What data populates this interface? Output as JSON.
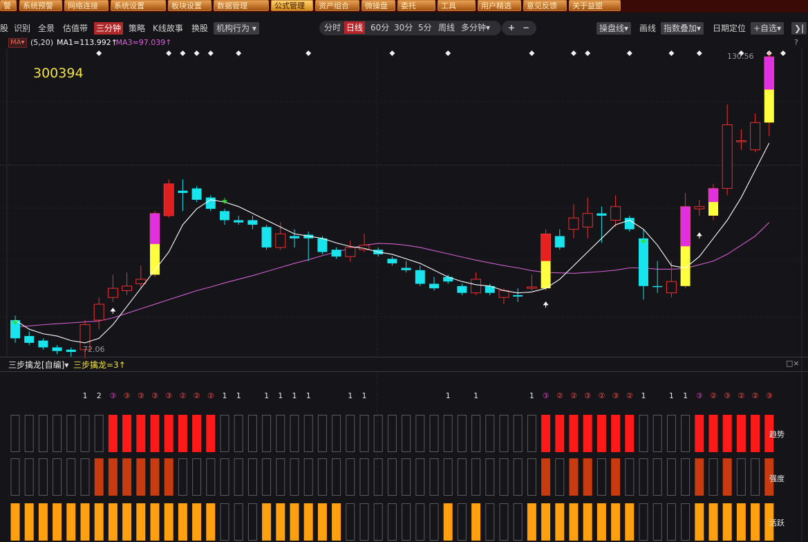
{
  "menu": {
    "items": [
      "警",
      "系统预警",
      "网络连接",
      "系统设置",
      "板块设置",
      "数据管理",
      "公式管理",
      "资产组合",
      "微操盘",
      "委托",
      "工具",
      "用户精选",
      "意见反馈",
      "关于益盟"
    ],
    "active_index": 6
  },
  "toolbar": {
    "left_items": [
      "股",
      "识别",
      "全景",
      "估值带",
      "三分钟",
      "策略",
      "K线故事",
      "换股"
    ],
    "selected_left": "三分钟",
    "org_behavior": "机构行为",
    "periods": [
      "分时",
      "日线",
      "60分",
      "30分",
      "5分",
      "周线",
      "多分钟"
    ],
    "selected_period": "日线",
    "plus": "+",
    "minus": "−",
    "right_items": [
      "操盘线",
      "画线",
      "指数叠加",
      "日期定位",
      "+自选"
    ],
    "collapse": "❯|"
  },
  "ma_legend": {
    "selector": "MA",
    "params": "(5,20)",
    "ma1": "MA1=113.992↑",
    "ma3": ",MA3=97.039↑"
  },
  "stock_code": "300394",
  "price_high_label": "130.56",
  "price_low_label": "72.06",
  "help_icon": "?",
  "indicator": {
    "name": "三步擒龙[自编]",
    "value": "三步擒龙=3↑",
    "close": "□×"
  },
  "row_labels": [
    "趋势",
    "强度",
    "活跃"
  ],
  "colors": {
    "up": "#f03030",
    "down": "#19e4ee",
    "ma1": "#ffffff",
    "ma3": "#d060d0",
    "trend": "#ff1a1a",
    "strength": "#c83a10",
    "activity": "#ffa010"
  },
  "signals": [
    {
      "i": 5,
      "t": "1"
    },
    {
      "i": 6,
      "t": "2"
    },
    {
      "i": 7,
      "t": "③",
      "c3": true
    },
    {
      "i": 8,
      "t": "③",
      "c": true
    },
    {
      "i": 9,
      "t": "③",
      "c": true
    },
    {
      "i": 10,
      "t": "③",
      "c": true
    },
    {
      "i": 11,
      "t": "③",
      "c": true
    },
    {
      "i": 12,
      "t": "②",
      "c": true
    },
    {
      "i": 13,
      "t": "②",
      "c": true
    },
    {
      "i": 14,
      "t": "②",
      "c": true
    },
    {
      "i": 15,
      "t": "1"
    },
    {
      "i": 16,
      "t": "1"
    },
    {
      "i": 18,
      "t": "1"
    },
    {
      "i": 19,
      "t": "1"
    },
    {
      "i": 20,
      "t": "1"
    },
    {
      "i": 21,
      "t": "1"
    },
    {
      "i": 24,
      "t": "1"
    },
    {
      "i": 25,
      "t": "1"
    },
    {
      "i": 31,
      "t": "1"
    },
    {
      "i": 33,
      "t": "1"
    },
    {
      "i": 37,
      "t": "1"
    },
    {
      "i": 38,
      "t": "③",
      "c3": true
    },
    {
      "i": 39,
      "t": "②",
      "c": true
    },
    {
      "i": 40,
      "t": "②",
      "c": true
    },
    {
      "i": 41,
      "t": "③",
      "c": true
    },
    {
      "i": 42,
      "t": "②",
      "c": true
    },
    {
      "i": 43,
      "t": "③",
      "c": true
    },
    {
      "i": 44,
      "t": "②",
      "c": true
    },
    {
      "i": 45,
      "t": "1"
    },
    {
      "i": 47,
      "t": "1"
    },
    {
      "i": 48,
      "t": "1"
    },
    {
      "i": 49,
      "t": "③",
      "c3": true
    },
    {
      "i": 50,
      "t": "②",
      "c": true
    },
    {
      "i": 51,
      "t": "③",
      "c": true
    },
    {
      "i": 52,
      "t": "②",
      "c": true
    },
    {
      "i": 53,
      "t": "②",
      "c": true
    },
    {
      "i": 54,
      "t": "③",
      "c": true
    }
  ],
  "trend_on": [
    7,
    8,
    9,
    10,
    11,
    12,
    13,
    14,
    38,
    39,
    40,
    41,
    42,
    43,
    44,
    49,
    50,
    51,
    52,
    53,
    54
  ],
  "strength_on": [
    6,
    7,
    8,
    9,
    10,
    11,
    38,
    40,
    41,
    43,
    49,
    51,
    54
  ],
  "activity_off": [
    15,
    16,
    17,
    24,
    25,
    26,
    27,
    28,
    29,
    30,
    32,
    34,
    35,
    36,
    45,
    46,
    47,
    48
  ],
  "diamonds": [
    6,
    11,
    12,
    13,
    14,
    16,
    21,
    27,
    31,
    37,
    40,
    41,
    44,
    47,
    49,
    52,
    54,
    55
  ],
  "candles": [
    {
      "o": 81,
      "c": 77,
      "h": 82,
      "l": 76
    },
    {
      "o": 77.5,
      "c": 76,
      "h": 78.5,
      "l": 75.5
    },
    {
      "o": 76.5,
      "c": 75,
      "h": 77,
      "l": 74.5
    },
    {
      "o": 75,
      "c": 74.2,
      "h": 75.5,
      "l": 73.5
    },
    {
      "o": 74.5,
      "c": 74,
      "h": 75,
      "l": 72.8
    },
    {
      "o": 74.5,
      "c": 80,
      "h": 81,
      "l": 72.5
    },
    {
      "o": 81,
      "c": 84.5,
      "h": 86,
      "l": 79
    },
    {
      "o": 86,
      "c": 88,
      "h": 91,
      "l": 85
    },
    {
      "o": 87.5,
      "c": 88.5,
      "h": 91.5,
      "l": 86.5
    },
    {
      "o": 89,
      "c": 90,
      "h": 93,
      "l": 88
    },
    {
      "o": 91,
      "c": 104.5,
      "h": 105,
      "l": 90.5
    },
    {
      "o": 104,
      "c": 111,
      "h": 112,
      "l": 103.5
    },
    {
      "o": 109.5,
      "c": 109,
      "h": 112,
      "l": 105
    },
    {
      "o": 110,
      "c": 107.5,
      "h": 110.5,
      "l": 107
    },
    {
      "o": 108,
      "c": 105.5,
      "h": 108.5,
      "l": 105
    },
    {
      "o": 105,
      "c": 103,
      "h": 105.5,
      "l": 102
    },
    {
      "o": 103,
      "c": 102.5,
      "h": 104,
      "l": 102
    },
    {
      "o": 103,
      "c": 102,
      "h": 104,
      "l": 101
    },
    {
      "o": 101.5,
      "c": 97,
      "h": 102,
      "l": 96.5
    },
    {
      "o": 97,
      "c": 100,
      "h": 102.5,
      "l": 96.5
    },
    {
      "o": 99.5,
      "c": 99,
      "h": 101,
      "l": 97
    },
    {
      "o": 99.8,
      "c": 99,
      "h": 100.5,
      "l": 94
    },
    {
      "o": 99,
      "c": 96,
      "h": 99.5,
      "l": 95.5
    },
    {
      "o": 96.5,
      "c": 95,
      "h": 97,
      "l": 94.5
    },
    {
      "o": 95,
      "c": 97,
      "h": 98.5,
      "l": 93.8
    },
    {
      "o": 96.5,
      "c": 97.5,
      "h": 100,
      "l": 96
    },
    {
      "o": 96.5,
      "c": 95.5,
      "h": 97,
      "l": 95
    },
    {
      "o": 94.5,
      "c": 93.5,
      "h": 95,
      "l": 93
    },
    {
      "o": 92.5,
      "c": 92,
      "h": 94,
      "l": 91.5
    },
    {
      "o": 92,
      "c": 89,
      "h": 93,
      "l": 88.5
    },
    {
      "o": 89,
      "c": 88,
      "h": 90.5,
      "l": 87.5
    },
    {
      "o": 90.5,
      "c": 89.5,
      "h": 91,
      "l": 89
    },
    {
      "o": 88.5,
      "c": 87,
      "h": 89,
      "l": 86.5
    },
    {
      "o": 87,
      "c": 90,
      "h": 91.5,
      "l": 86.5
    },
    {
      "o": 88.5,
      "c": 87,
      "h": 89,
      "l": 86.5
    },
    {
      "o": 86,
      "c": 87.5,
      "h": 88,
      "l": 84.5
    },
    {
      "o": 86.5,
      "c": 86.2,
      "h": 88,
      "l": 85
    },
    {
      "o": 88,
      "c": 88.3,
      "h": 91,
      "l": 87.5
    },
    {
      "o": 88,
      "c": 100,
      "h": 101,
      "l": 87.5
    },
    {
      "o": 99.5,
      "c": 97,
      "h": 101,
      "l": 96.5
    },
    {
      "o": 101,
      "c": 103.5,
      "h": 106.5,
      "l": 99
    },
    {
      "o": 101.5,
      "c": 104.5,
      "h": 108,
      "l": 99
    },
    {
      "o": 104.5,
      "c": 104,
      "h": 106,
      "l": 98
    },
    {
      "o": 103,
      "c": 106,
      "h": 108.5,
      "l": 101.5
    },
    {
      "o": 103.5,
      "c": 101,
      "h": 104,
      "l": 100.5
    },
    {
      "o": 99,
      "c": 88.5,
      "h": 101,
      "l": 85.5
    },
    {
      "o": 88.5,
      "c": 88.3,
      "h": 94,
      "l": 87
    },
    {
      "o": 87,
      "c": 89.5,
      "h": 94,
      "l": 86
    },
    {
      "o": 88.5,
      "c": 106,
      "h": 109,
      "l": 88
    },
    {
      "o": 105.5,
      "c": 106,
      "h": 107.5,
      "l": 104
    },
    {
      "o": 104,
      "c": 110,
      "h": 111,
      "l": 103
    },
    {
      "o": 110,
      "c": 124,
      "h": 128.5,
      "l": 108.5
    },
    {
      "o": 120.5,
      "c": 120.5,
      "h": 123,
      "l": 118.5
    },
    {
      "o": 118.5,
      "c": 124.5,
      "h": 126.5,
      "l": 118
    },
    {
      "o": 124.5,
      "c": 139,
      "h": 140,
      "l": 121.5
    }
  ],
  "ma1": [
    81,
    79,
    78,
    77.5,
    76.5,
    76,
    77,
    80,
    84,
    88,
    92,
    96,
    102,
    105.5,
    107.5,
    107,
    106,
    104.5,
    103,
    101.5,
    100,
    99.5,
    99,
    98,
    97.2,
    96.8,
    96,
    95.5,
    94.5,
    93.5,
    92,
    90.5,
    89.5,
    88.8,
    88.5,
    87.5,
    87,
    87.2,
    88,
    90,
    93,
    96,
    99,
    102,
    103,
    101,
    97.5,
    93,
    92.5,
    95,
    99,
    103,
    108,
    114,
    120
  ],
  "ma3": [
    79.5,
    79.7,
    80,
    80.2,
    80.4,
    80.6,
    80.8,
    81.5,
    82.5,
    83.5,
    84.5,
    85.5,
    86.5,
    87.5,
    88.3,
    89.2,
    90,
    90.8,
    91.7,
    92.6,
    93.5,
    94.3,
    95.2,
    96,
    96.8,
    97.5,
    97.9,
    97.8,
    97.5,
    97,
    96.3,
    95.6,
    94.9,
    94.2,
    93.6,
    93,
    92.5,
    91.9,
    91.5,
    91.4,
    91.3,
    91.5,
    91.7,
    92,
    92.5,
    92.5,
    92.2,
    92.2,
    92.4,
    93.2,
    94,
    95.5,
    97.5,
    99.5,
    102.5
  ]
}
